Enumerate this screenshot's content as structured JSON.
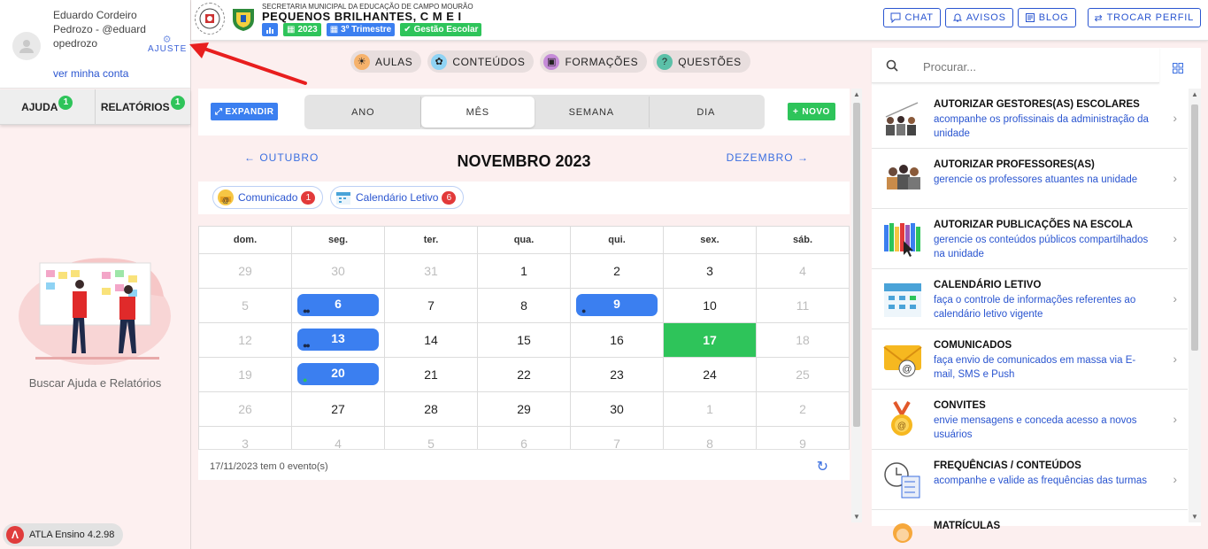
{
  "user": {
    "name": "Eduardo Cordeiro Pedrozo - @eduardopedrozo",
    "settings_label": "AJUSTE",
    "account_link": "ver minha conta"
  },
  "help_tabs": [
    {
      "label": "AJUDA",
      "count": "1"
    },
    {
      "label": "RELATÓRIOS",
      "count": "1"
    }
  ],
  "help_caption": "Buscar Ajuda e Relatórios",
  "version": "ATLA Ensino 4.2.98",
  "header": {
    "secretaria": "SECRETARIA MUNICIPAL DA EDUCAÇÃO DE CAMPO MOURÃO",
    "school": "PEQUENOS BRILHANTES, C M E I",
    "chips": {
      "year": "2023",
      "term": "3º Trimestre",
      "management": "Gestão Escolar"
    },
    "buttons": {
      "chat": "CHAT",
      "avisos": "AVISOS",
      "blog": "BLOG",
      "perfil": "TROCAR PERFIL"
    }
  },
  "modules": [
    "AULAS",
    "CONTEÚDOS",
    "FORMAÇÕES",
    "QUESTÕES"
  ],
  "calendar": {
    "expand_label": "EXPANDIR",
    "views": [
      "ANO",
      "MÊS",
      "SEMANA",
      "DIA"
    ],
    "active_view": "MÊS",
    "new_label": "NOVO",
    "prev_month": "OUTUBRO",
    "next_month": "DEZEMBRO",
    "title": "NOVEMBRO 2023",
    "legend": [
      {
        "label": "Comunicado",
        "count": "1"
      },
      {
        "label": "Calendário Letivo",
        "count": "6"
      }
    ],
    "weekdays": [
      "dom.",
      "seg.",
      "ter.",
      "qua.",
      "qui.",
      "sex.",
      "sáb."
    ],
    "weeks": [
      [
        "29",
        "30",
        "31",
        "1",
        "2",
        "3",
        "4"
      ],
      [
        "5",
        "6",
        "7",
        "8",
        "9",
        "10",
        "11"
      ],
      [
        "12",
        "13",
        "14",
        "15",
        "16",
        "17",
        "18"
      ],
      [
        "19",
        "20",
        "21",
        "22",
        "23",
        "24",
        "25"
      ],
      [
        "26",
        "27",
        "28",
        "29",
        "30",
        "1",
        "2"
      ],
      [
        "3",
        "4",
        "5",
        "6",
        "7",
        "8",
        "9"
      ]
    ],
    "footer": "17/11/2023 tem 0 evento(s)"
  },
  "search": {
    "placeholder": "Procurar..."
  },
  "menu": [
    {
      "title": "AUTORIZAR GESTORES(AS) ESCOLARES",
      "desc": "acompanhe os profissinais da administração da unidade"
    },
    {
      "title": "AUTORIZAR PROFESSORES(AS)",
      "desc": "gerencie os professores atuantes na unidade"
    },
    {
      "title": "AUTORIZAR PUBLICAÇÕES NA ESCOLA",
      "desc": "gerencie os conteúdos públicos compartilhados na unidade"
    },
    {
      "title": "CALENDÁRIO LETIVO",
      "desc": "faça o controle de informações referentes ao calendário letivo vigente"
    },
    {
      "title": "COMUNICADOS",
      "desc": "faça envio de comunicados em massa via E-mail, SMS e Push"
    },
    {
      "title": "CONVITES",
      "desc": "envie mensagens e conceda acesso a novos usuários"
    },
    {
      "title": "FREQUÊNCIAS / CONTEÚDOS",
      "desc": "acompanhe e valide as frequências das turmas"
    },
    {
      "title": "MATRÍCULAS",
      "desc": ""
    }
  ],
  "colors": {
    "primary": "#3b7ff0",
    "success": "#2ec45a",
    "link": "#2a55d0",
    "danger": "#e23a3a"
  }
}
